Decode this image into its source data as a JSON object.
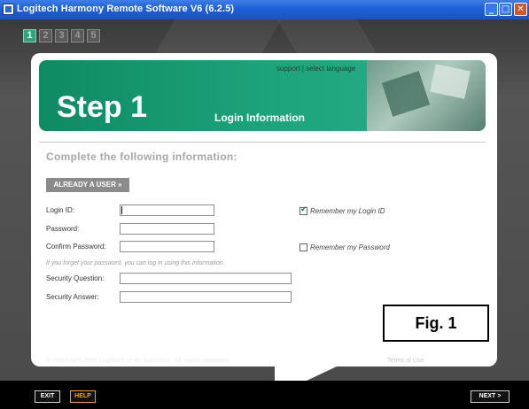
{
  "window": {
    "title": "Logitech Harmony Remote Software V6 (6.2.5)",
    "minimize_glyph": "_",
    "maximize_glyph": "□",
    "close_glyph": "✕"
  },
  "steps": [
    "1",
    "2",
    "3",
    "4",
    "5"
  ],
  "active_step": "1",
  "banner": {
    "links": "support | select language",
    "title": "Step 1",
    "subtitle": "Login Information"
  },
  "form": {
    "instructions": "Complete the following information:",
    "already_user_button": "ALREADY A USER »",
    "login_id_label": "Login ID:",
    "login_id_value": "",
    "password_label": "Password:",
    "password_value": "",
    "confirm_password_label": "Confirm Password:",
    "confirm_password_value": "",
    "hint": "If you forget your password, you can log in using this information.",
    "security_question_label": "Security Question:",
    "security_question_value": "",
    "security_answer_label": "Security Answer:",
    "security_answer_value": "",
    "remember_login": {
      "label": "Remember my Login ID",
      "checked": true,
      "mark": "✔"
    },
    "remember_password": {
      "label": "Remember my Password",
      "checked": false
    }
  },
  "annotation": "Fig. 1",
  "footer": {
    "copyright": "© Copyright 2006 Logitech or its licensors. All rights reserved.",
    "terms": "Terms of Use"
  },
  "nav": {
    "exit": "EXIT",
    "help": "HELP",
    "next": "NEXT >"
  },
  "colors": {
    "titlebar": "#1f5fd6",
    "brand_green": "#1ea57b",
    "help_orange": "#f3a32b",
    "background_dark": "#4a4a4a"
  }
}
